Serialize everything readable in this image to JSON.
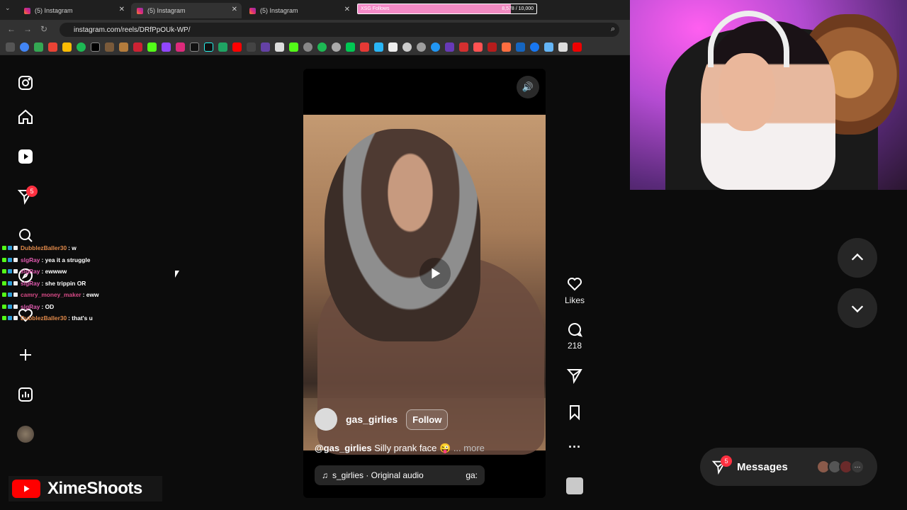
{
  "browser": {
    "tabs": [
      {
        "label": "(5) Instagram",
        "active": false
      },
      {
        "label": "(5) Instagram",
        "active": true
      },
      {
        "label": "(5) Instagram",
        "active": false
      }
    ],
    "url": "instagram.com/reels/DRfPpOUk-WP/",
    "goal_widget": {
      "label": "XSG Follows",
      "value": "8,578 / 10,000",
      "progress": 0.8578
    }
  },
  "sidebar": {
    "notifications_badge": "5"
  },
  "chat": [
    {
      "user": "DubblezBaller30",
      "color": "#e0894a",
      "message": ": w"
    },
    {
      "user": "slgRay",
      "color": "#e05bb0",
      "message": ": yea it a struggle"
    },
    {
      "user": "slgRay",
      "color": "#e05bb0",
      "message": ": ewwww"
    },
    {
      "user": "slgRay",
      "color": "#e05bb0",
      "message": ": she trippin OR"
    },
    {
      "user": "camry_money_maker",
      "color": "#d64a86",
      "message": ": eww"
    },
    {
      "user": "slgRay",
      "color": "#e05bb0",
      "message": ": OD"
    },
    {
      "user": "DubblezBaller30",
      "color": "#e0894a",
      "message": ": that's u"
    }
  ],
  "reel": {
    "author": "gas_girlies",
    "follow_label": "Follow",
    "caption_handle": "@gas_girlies",
    "caption_text": "Silly prank face 😜",
    "caption_more": "... more",
    "audio": "s_girlies · Original audio",
    "audio_trail": "ga:"
  },
  "actions": {
    "likes_label": "Likes",
    "comments_count": "218"
  },
  "messages": {
    "label": "Messages",
    "badge": "5"
  },
  "brand": {
    "name": "XimeShoots"
  },
  "colors": {
    "accent_badge": "#ff3040",
    "background": "#0c0c0c"
  }
}
